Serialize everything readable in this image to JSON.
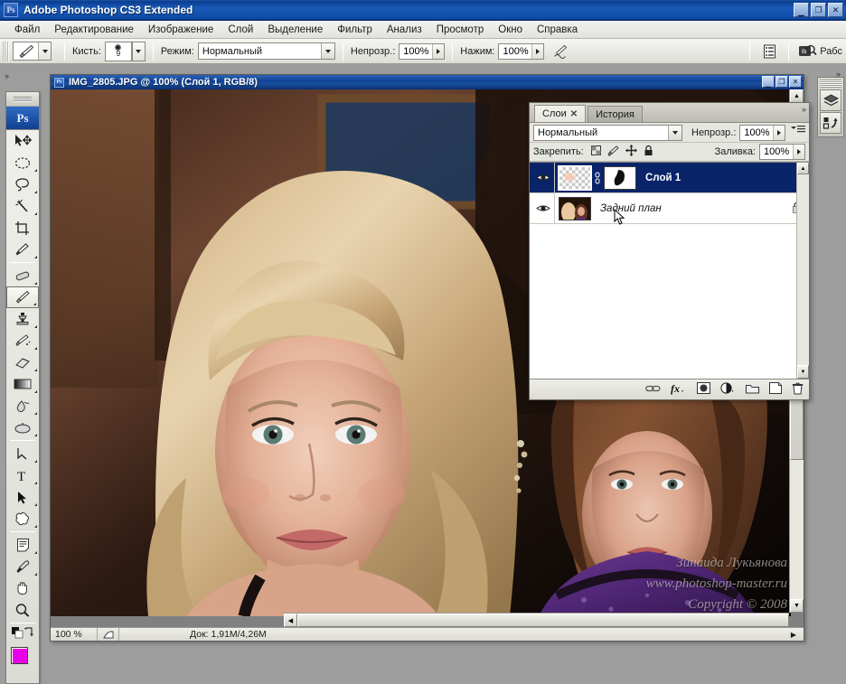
{
  "app": {
    "title": "Adobe Photoshop CS3 Extended",
    "badge": "Ps",
    "window_buttons": {
      "minimize": "_",
      "maximize": "❐",
      "close": "✕"
    }
  },
  "menubar": {
    "items": [
      {
        "label": "Файл"
      },
      {
        "label": "Редактирование"
      },
      {
        "label": "Изображение"
      },
      {
        "label": "Слой"
      },
      {
        "label": "Выделение"
      },
      {
        "label": "Фильтр"
      },
      {
        "label": "Анализ"
      },
      {
        "label": "Просмотр"
      },
      {
        "label": "Окно"
      },
      {
        "label": "Справка"
      }
    ]
  },
  "options_bar": {
    "tool_icon": "brush-tool-icon",
    "brush_label": "Кисть:",
    "brush_size": "9",
    "mode_label": "Режим:",
    "mode_value": "Нормальный",
    "opacity_label": "Непрозр.:",
    "opacity_value": "100%",
    "flow_label": "Нажим:",
    "flow_value": "100%",
    "airbrush_icon": "airbrush-icon",
    "palettes_icon": "palettes-toggle-icon",
    "bridge_icon": "bridge-icon",
    "workspace_label": "Рабс"
  },
  "toolbox": {
    "badge": "Ps",
    "tools": [
      {
        "name": "move-tool",
        "title": "Перемещение"
      },
      {
        "name": "elliptical-marquee-tool",
        "title": "Овальная область"
      },
      {
        "name": "lasso-tool",
        "title": "Лассо"
      },
      {
        "name": "magic-wand-tool",
        "title": "Волшебная палочка"
      },
      {
        "name": "crop-tool",
        "title": "Рамка"
      },
      {
        "name": "slice-tool",
        "title": "Раскройка"
      },
      {
        "name": "healing-brush-tool",
        "title": "Восстанавливающая кисть"
      },
      {
        "name": "brush-tool",
        "title": "Кисть"
      },
      {
        "name": "clone-stamp-tool",
        "title": "Штамп"
      },
      {
        "name": "history-brush-tool",
        "title": "Архивная кисть"
      },
      {
        "name": "eraser-tool",
        "title": "Ластик"
      },
      {
        "name": "gradient-tool",
        "title": "Градиент"
      },
      {
        "name": "blur-tool",
        "title": "Размытие"
      },
      {
        "name": "dodge-tool",
        "title": "Осветлитель"
      },
      {
        "name": "pen-tool",
        "title": "Перо"
      },
      {
        "name": "type-tool",
        "title": "Текст"
      },
      {
        "name": "path-selection-tool",
        "title": "Выделение контура"
      },
      {
        "name": "shape-tool",
        "title": "Произвольная фигура"
      },
      {
        "name": "notes-tool",
        "title": "Комментарий"
      },
      {
        "name": "eyedropper-tool",
        "title": "Пипетка"
      },
      {
        "name": "hand-tool",
        "title": "Рука"
      },
      {
        "name": "zoom-tool",
        "title": "Масштаб"
      }
    ],
    "foreground_color": "#e800e8",
    "background_color": "#ffffff"
  },
  "document": {
    "title": "IMG_2805.JPG @ 100% (Слой 1, RGB/8)",
    "window_buttons": {
      "minimize": "_",
      "maximize": "❐",
      "close": "✕"
    },
    "status": {
      "zoom": "100 %",
      "doc_info": "Док: 1,91M/4,26M"
    },
    "watermark": [
      "Зинаида Лукьянова",
      "www.photoshop-master.ru",
      "Copyright © 2008"
    ]
  },
  "layers_panel": {
    "tabs": [
      {
        "label": "Слои",
        "active": true,
        "closable": true
      },
      {
        "label": "История",
        "active": false,
        "closable": false
      }
    ],
    "blend_mode": "Нормальный",
    "opacity_label": "Непрозр.:",
    "opacity_value": "100%",
    "lock_label": "Закрепить:",
    "lock_icons": [
      "lock-transparent-icon",
      "lock-paint-icon",
      "lock-position-icon",
      "lock-all-icon"
    ],
    "fill_label": "Заливка:",
    "fill_value": "100%",
    "layers": [
      {
        "name": "Слой 1",
        "selected": true,
        "visible": true,
        "thumbnail": "transparent-checker",
        "has_mask": true,
        "link_icon": "mask-link-icon",
        "locked": false
      },
      {
        "name": "Задний план",
        "selected": false,
        "visible": true,
        "thumbnail": "photo",
        "has_mask": false,
        "locked": true,
        "lock_icon": "lock-icon"
      }
    ],
    "bottom_buttons": [
      {
        "name": "link-layers-button",
        "icon": "chain-icon"
      },
      {
        "name": "layer-styles-button",
        "icon": "fx-icon"
      },
      {
        "name": "add-mask-button",
        "icon": "mask-icon"
      },
      {
        "name": "adjustment-layer-button",
        "icon": "half-circle-icon"
      },
      {
        "name": "new-group-button",
        "icon": "folder-icon"
      },
      {
        "name": "new-layer-button",
        "icon": "new-page-icon"
      },
      {
        "name": "delete-layer-button",
        "icon": "trash-icon"
      }
    ]
  },
  "right_dock": {
    "buttons": [
      {
        "name": "layer-comps-icon"
      },
      {
        "name": "history-snapshot-icon"
      }
    ]
  }
}
